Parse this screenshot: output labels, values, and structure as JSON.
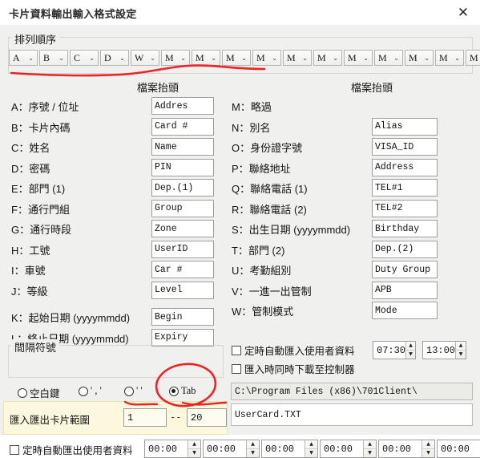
{
  "window": {
    "title": "卡片資料輸出輸入格式設定",
    "close_icon": "close-icon",
    "close_glyph": "✕"
  },
  "order_group": {
    "legend": "排列順序",
    "combo_arrow": "⌄",
    "combos": [
      {
        "value": "A"
      },
      {
        "value": "B"
      },
      {
        "value": "C"
      },
      {
        "value": "D"
      },
      {
        "value": "W"
      },
      {
        "value": "M"
      },
      {
        "value": "M"
      },
      {
        "value": "M"
      },
      {
        "value": "M"
      },
      {
        "value": "M"
      },
      {
        "value": "M"
      },
      {
        "value": "M"
      },
      {
        "value": "M"
      },
      {
        "value": "M"
      },
      {
        "value": "M"
      },
      {
        "value": "M"
      }
    ]
  },
  "columns": {
    "left_header": "檔案抬頭",
    "right_header": "檔案抬頭"
  },
  "left_fields": [
    {
      "key": "A",
      "label": "A：序號 / 位址",
      "value": "Addres"
    },
    {
      "key": "B",
      "label": "B：卡片內碼",
      "value": "Card #"
    },
    {
      "key": "C",
      "label": "C：姓名",
      "value": "Name"
    },
    {
      "key": "D",
      "label": "D：密碼",
      "value": "PIN"
    },
    {
      "key": "E",
      "label": "E：部門 (1)",
      "value": "Dep.(1)"
    },
    {
      "key": "F",
      "label": "F：通行門組",
      "value": "Group"
    },
    {
      "key": "G",
      "label": "G：通行時段",
      "value": "Zone"
    },
    {
      "key": "H",
      "label": "H：工號",
      "value": "UserID"
    },
    {
      "key": "I",
      "label": "I：車號",
      "value": "Car #"
    },
    {
      "key": "J",
      "label": "J：等級",
      "value": "Level"
    },
    {
      "key": "K",
      "label": "K：起始日期 (yyyymmdd)",
      "value": "Begin"
    },
    {
      "key": "L",
      "label": "L：終止日期 (yyyymmdd)",
      "value": "Expiry"
    }
  ],
  "right_fields": [
    {
      "key": "M",
      "label": "M：略過",
      "value": ""
    },
    {
      "key": "N",
      "label": "N：別名",
      "value": "Alias"
    },
    {
      "key": "O",
      "label": "O：身份證字號",
      "value": "VISA_ID"
    },
    {
      "key": "P",
      "label": "P：聯絡地址",
      "value": "Address"
    },
    {
      "key": "Q",
      "label": "Q：聯絡電話 (1)",
      "value": "TEL#1"
    },
    {
      "key": "R",
      "label": "R：聯絡電話 (2)",
      "value": "TEL#2"
    },
    {
      "key": "S",
      "label": "S：出生日期 (yyyymmdd)",
      "value": "Birthday"
    },
    {
      "key": "T",
      "label": "T：部門 (2)",
      "value": "Dep.(2)"
    },
    {
      "key": "U",
      "label": "U：考勤組別",
      "value": "Duty Group"
    },
    {
      "key": "V",
      "label": "V：一進一出管制",
      "value": "APB"
    },
    {
      "key": "W",
      "label": "W：管制模式",
      "value": "Mode"
    }
  ],
  "import_options": {
    "auto_import": {
      "label": "定時自動匯入使用者資料",
      "checked": false
    },
    "download_on_import": {
      "label": "匯入時同時下載至控制器",
      "checked": false
    },
    "time1": "07:30",
    "time2": "13:00"
  },
  "paths": {
    "directory": "C:\\Program Files (x86)\\701Client\\",
    "filename": "UserCard.TXT"
  },
  "separator_group": {
    "legend": "間隔符號",
    "options": [
      {
        "label": "空白鍵",
        "selected": false
      },
      {
        "label": "' , '",
        "selected": false
      },
      {
        "label": "'  '",
        "selected": false
      },
      {
        "label": "Tab",
        "selected": true
      }
    ]
  },
  "card_range": {
    "label": "匯入匯出卡片範圍",
    "from": "1",
    "dash": "--",
    "to": "20"
  },
  "auto_export": {
    "label": "定時自動匯出使用者資料",
    "checked": false,
    "times": [
      "00:00",
      "00:00",
      "00:00",
      "00:00",
      "00:00",
      "00:00"
    ]
  },
  "spinner": {
    "up_glyph": "▲",
    "down_glyph": "▼"
  },
  "annotations": {
    "underline_color": "#ee2222",
    "circle_color": "#ee2222"
  }
}
